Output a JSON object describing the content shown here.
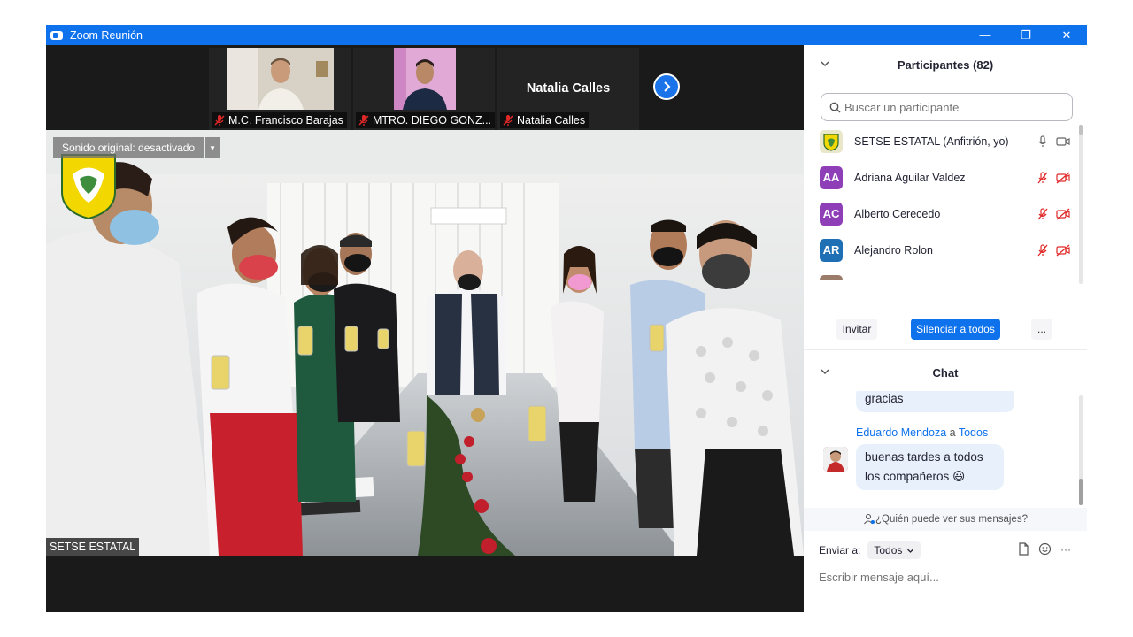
{
  "window": {
    "title": "Zoom Reunión",
    "minimize": "—",
    "restore": "❐",
    "close": "✕"
  },
  "thumbnails": [
    {
      "name": "M.C. Francisco Barajas",
      "muted": true,
      "has_video": true
    },
    {
      "name": "MTRO. DIEGO GONZ...",
      "muted": true,
      "has_video": true
    },
    {
      "name": "Natalia Calles",
      "display_name": "Natalia Calles",
      "muted": true,
      "has_video": false
    }
  ],
  "main_video": {
    "sound_badge": "Sonido original: desactivado",
    "participant_name": "SETSE ESTATAL"
  },
  "participants_panel": {
    "title": "Participantes (82)",
    "search_placeholder": "Buscar un participante",
    "participants": [
      {
        "initials": "",
        "name": "SETSE ESTATAL (Anfitrión, yo)",
        "avatar_color": "#e9e7c9",
        "mic": "on",
        "video": "on"
      },
      {
        "initials": "AA",
        "name": "Adriana Aguilar Valdez",
        "avatar_color": "#8e3fb8",
        "mic": "muted",
        "video": "off"
      },
      {
        "initials": "AC",
        "name": "Alberto Cerecedo",
        "avatar_color": "#8e3fb8",
        "mic": "muted",
        "video": "off"
      },
      {
        "initials": "AR",
        "name": "Alejandro Rolon",
        "avatar_color": "#1f6fb5",
        "mic": "muted",
        "video": "off"
      }
    ],
    "invite_label": "Invitar",
    "mute_all_label": "Silenciar a todos",
    "more_label": "..."
  },
  "chat_panel": {
    "title": "Chat",
    "messages": [
      {
        "sender": "",
        "to": "",
        "text": "gracias"
      },
      {
        "sender": "Eduardo Mendoza",
        "to": "Todos",
        "text_line1": "buenas tardes a todos",
        "text_line2": "los compañeros",
        "emoji": "😃"
      }
    ],
    "to_word": "a",
    "who_sees": "¿Quién puede ver sus mensajes?",
    "send_to_label": "Enviar a:",
    "send_to_value": "Todos",
    "input_placeholder": "Escribir mensaje aquí...",
    "more_icon": "···"
  },
  "colors": {
    "zoom_blue": "#0e72ed",
    "muted_red": "#e02828",
    "bubble_bg": "#e8f1fb"
  }
}
